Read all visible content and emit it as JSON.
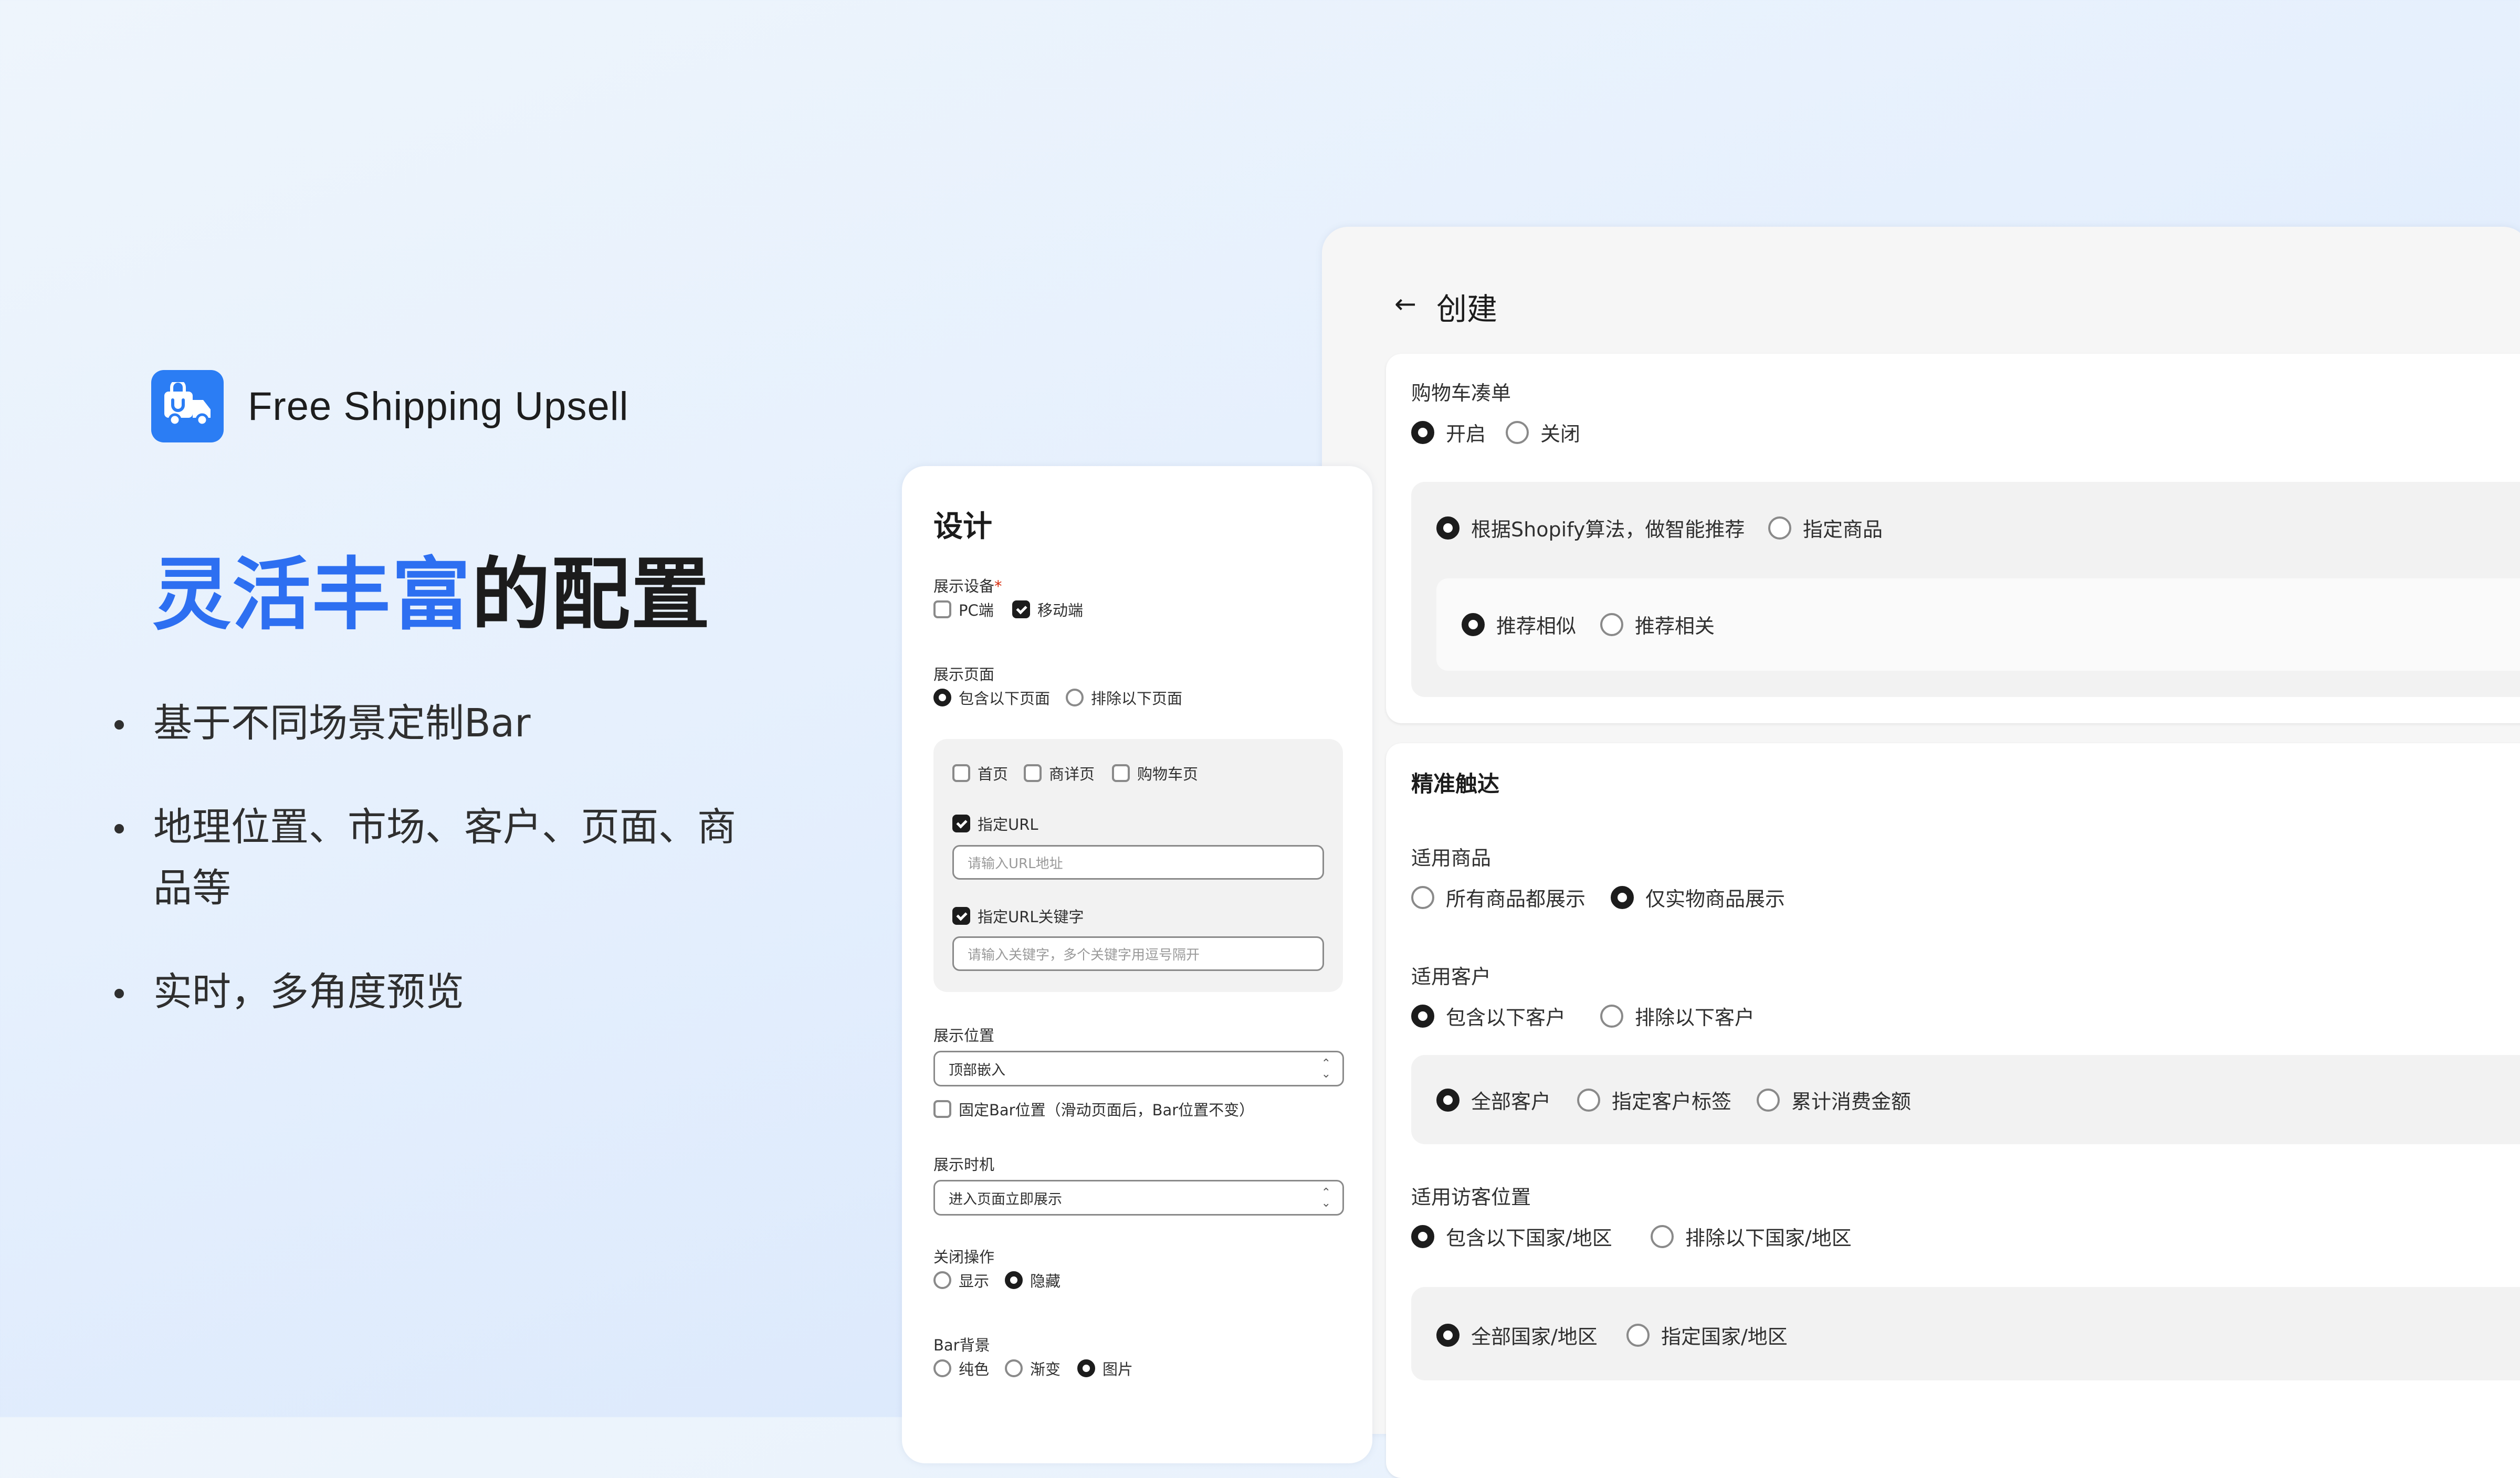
{
  "brand": {
    "name": "Free Shipping Upsell",
    "icon": "truck-bag-icon",
    "accent": "#2b7df4"
  },
  "hero": {
    "headline_highlight": "灵活丰富",
    "headline_rest": "的配置",
    "highlight_color": "#2d6ff1",
    "bullets": [
      "基于不同场景定制Bar",
      "地理位置、市场、客户、页面、商品等",
      "实时，多角度预览"
    ]
  },
  "design": {
    "title": "设计",
    "device": {
      "label": "展示设备",
      "required": "*",
      "pc": "PC端",
      "mobile": "移动端",
      "pc_checked": false,
      "mobile_checked": true
    },
    "page": {
      "label": "展示页面",
      "include": "包含以下页面",
      "exclude": "排除以下页面",
      "selected": "include",
      "home": "首页",
      "detail": "商详页",
      "cart": "购物车页",
      "url": "指定URL",
      "url_placeholder": "请输入URL地址",
      "keyword": "指定URL关键字",
      "keyword_placeholder": "请输入关键字，多个关键字用逗号隔开"
    },
    "position": {
      "label": "展示位置",
      "value": "顶部嵌入",
      "fixed": "固定Bar位置（滑动页面后，Bar位置不变）"
    },
    "timing": {
      "label": "展示时机",
      "value": "进入页面立即展示"
    },
    "close": {
      "label": "关闭操作",
      "show": "显示",
      "hide": "隐藏",
      "selected": "hide"
    },
    "background": {
      "label": "Bar背景",
      "solid": "纯色",
      "gradient": "渐变",
      "image": "图片",
      "selected": "image"
    }
  },
  "create": {
    "back_icon": "arrow-left-icon",
    "title": "创建",
    "cart": {
      "label": "购物车凑单",
      "on": "开启",
      "off": "关闭",
      "selected": "on",
      "smart": "根据Shopify算法，做智能推荐",
      "specified": "指定商品",
      "similar": "推荐相似",
      "related": "推荐相关"
    },
    "targeting": {
      "title": "精准触达",
      "products": {
        "label": "适用商品",
        "all": "所有商品都展示",
        "physical": "仅实物商品展示",
        "selected": "physical"
      },
      "customers": {
        "label": "适用客户",
        "include": "包含以下客户",
        "exclude": "排除以下客户",
        "all": "全部客户",
        "tag": "指定客户标签",
        "spend": "累计消费金额"
      },
      "location": {
        "label": "适用访客位置",
        "include": "包含以下国家/地区",
        "exclude": "排除以下国家/地区",
        "all": "全部国家/地区",
        "specified": "指定国家/地区"
      }
    }
  }
}
